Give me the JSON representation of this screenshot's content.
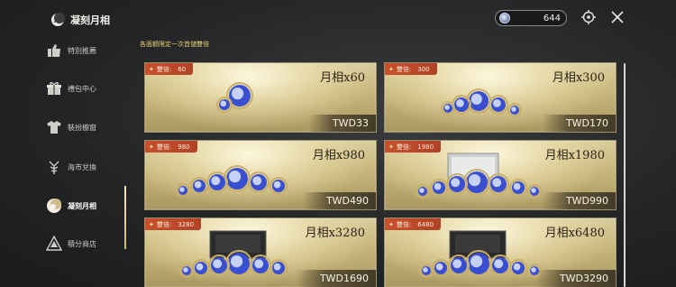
{
  "header": {
    "title": "凝刻月相",
    "currency_value": "644"
  },
  "sidebar": {
    "items": [
      {
        "label": "特別推薦",
        "icon": "recommend-icon"
      },
      {
        "label": "禮包中心",
        "icon": "gift-icon"
      },
      {
        "label": "裝扮櫥窗",
        "icon": "outfit-icon"
      },
      {
        "label": "海市兌換",
        "icon": "exchange-icon"
      },
      {
        "label": "凝刻月相",
        "icon": "moon-crystal-icon",
        "active": true
      },
      {
        "label": "積分商店",
        "icon": "points-shop-icon"
      }
    ]
  },
  "notice": "各面額限定一次首儲雙倍",
  "products": [
    {
      "bonus_label": "雙倍:",
      "bonus_value": "60",
      "name": "月相x60",
      "price": "TWD33"
    },
    {
      "bonus_label": "雙倍:",
      "bonus_value": "300",
      "name": "月相x300",
      "price": "TWD170"
    },
    {
      "bonus_label": "雙倍:",
      "bonus_value": "980",
      "name": "月相x980",
      "price": "TWD490"
    },
    {
      "bonus_label": "雙倍:",
      "bonus_value": "1980",
      "name": "月相x1980",
      "price": "TWD990"
    },
    {
      "bonus_label": "雙倍:",
      "bonus_value": "3280",
      "name": "月相x3280",
      "price": "TWD1690"
    },
    {
      "bonus_label": "雙倍:",
      "bonus_value": "6480",
      "name": "月相x6480",
      "price": "TWD3290"
    }
  ],
  "colors": {
    "accent_gold": "#e9cf7a",
    "badge": "#c8502c",
    "card_gold": "#c6b57a"
  }
}
